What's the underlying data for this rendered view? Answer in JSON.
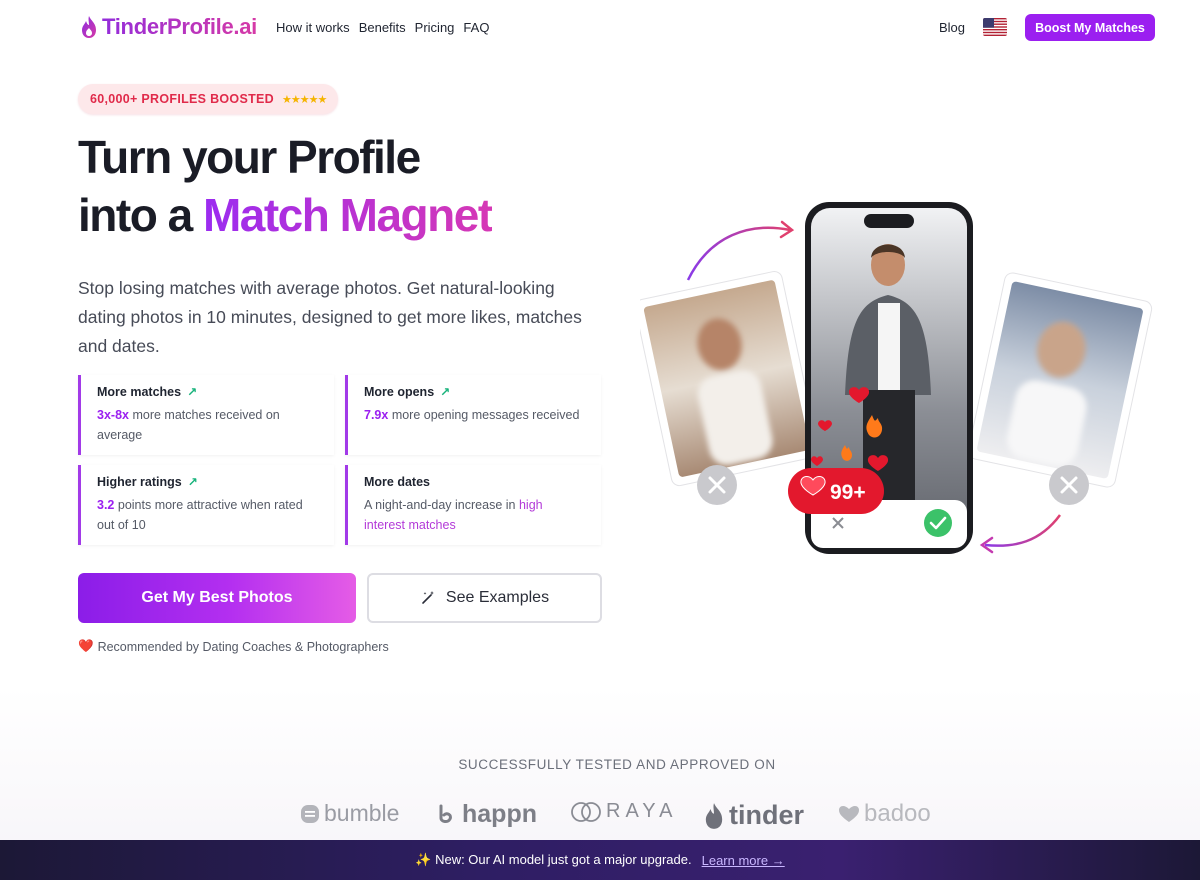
{
  "header": {
    "logo_text": "TinderProfile.ai",
    "nav": [
      "How it works",
      "Benefits",
      "Pricing",
      "FAQ"
    ],
    "blog_label": "Blog",
    "cta_label": "Boost My Matches"
  },
  "hero": {
    "badge_text": "60,000+ PROFILES BOOSTED",
    "badge_stars": "★★★★★",
    "title_line1": "Turn your Profile",
    "title_line2_prefix": "into a ",
    "title_line2_highlight": "Match Magnet",
    "lead": "Stop losing matches with average photos. Get natural-looking dating photos in 10 minutes, designed to get more likes, matches and dates.",
    "stats": [
      {
        "title": "More matches",
        "highlight": "3x-8x",
        "body": " more matches received on average"
      },
      {
        "title": "More opens",
        "highlight": "7.9x",
        "body": " more opening messages received"
      },
      {
        "title": "Higher ratings",
        "highlight": "3.2",
        "body": " points more attractive when rated out of 10"
      },
      {
        "title": "More dates",
        "body_prefix": "A night-and-day increase in ",
        "highlight": "high interest matches"
      }
    ],
    "primary_cta": "Get My Best Photos",
    "secondary_cta": "See Examples",
    "recommended": "Recommended by Dating Coaches & Photographers",
    "likes_badge": "99+"
  },
  "platforms": {
    "heading": "SUCCESSFULLY TESTED AND APPROVED ON",
    "items": [
      "bumble",
      "happn",
      "RAYA",
      "tinder",
      "badoo"
    ]
  },
  "banner": {
    "text": "✨ New: Our AI model just got a major upgrade.",
    "link": "Learn more →"
  },
  "colors": {
    "accent": "#9b1ff0",
    "accent_pink": "#d638b5",
    "badge_red": "#e02a4a",
    "trend_green": "#16b27a"
  }
}
